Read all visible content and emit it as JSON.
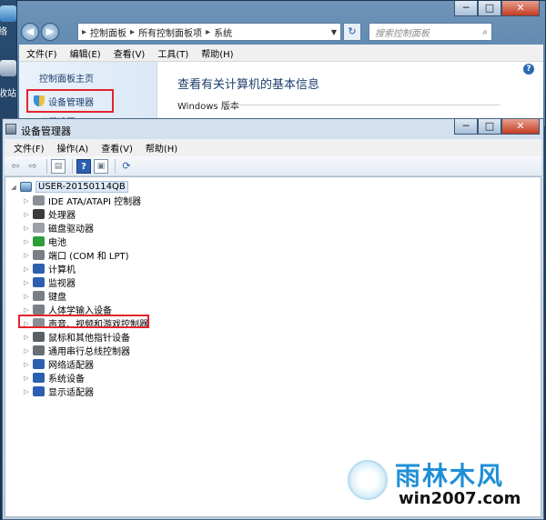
{
  "desktop": {
    "icon_label_1": "络",
    "icon_label_2": "收站"
  },
  "control_panel_window": {
    "caption_min": "─",
    "caption_max": "□",
    "caption_close": "✕",
    "nav_back": "◀",
    "nav_forward": "▶",
    "address_segments": [
      "控制面板",
      "所有控制面板项",
      "系统"
    ],
    "address_separator": "▸",
    "address_dropdown": "▼",
    "refresh": "↻",
    "search_placeholder": "搜索控制面板",
    "menu": [
      "文件(F)",
      "编辑(E)",
      "查看(V)",
      "工具(T)",
      "帮助(H)"
    ],
    "sidebar": {
      "home": "控制面板主页",
      "device_manager": "设备管理器",
      "remote_settings": "远程设置"
    },
    "help": "?",
    "heading": "查看有关计算机的基本信息",
    "section": "Windows 版本"
  },
  "device_manager_window": {
    "title": "设备管理器",
    "caption_min": "─",
    "caption_max": "□",
    "caption_close": "✕",
    "menu": [
      "文件(F)",
      "操作(A)",
      "查看(V)",
      "帮助(H)"
    ],
    "toolbar": {
      "back": "⇦",
      "forward": "⇨",
      "properties": "▤",
      "help": "?",
      "view": "▣",
      "scan": "⟳"
    },
    "root": "USER-20150114QB",
    "expand_glyph": "▷",
    "collapse_glyph": "◢",
    "devices": [
      "IDE ATA/ATAPI 控制器",
      "处理器",
      "磁盘驱动器",
      "电池",
      "端口 (COM 和 LPT)",
      "计算机",
      "监视器",
      "键盘",
      "人体学输入设备",
      "声音、视频和游戏控制器",
      "鼠标和其他指针设备",
      "通用串行总线控制器",
      "网络适配器",
      "系统设备",
      "显示适配器"
    ],
    "device_icon_colors": [
      "#8a8f96",
      "#3b3b3b",
      "#9aa0a6",
      "#2f9e3a",
      "#7a7f86",
      "#2d5fb0",
      "#2d5fb0",
      "#7a7f86",
      "#7a7f86",
      "#8a8f96",
      "#5a5f66",
      "#6a6f76",
      "#2d5fb0",
      "#2d5fb0",
      "#2d5fb0"
    ]
  },
  "watermark": {
    "brand": "雨林木风",
    "url": "win2007.com"
  },
  "colors": {
    "highlight": "#e3242b",
    "link": "#1e3f6e"
  }
}
